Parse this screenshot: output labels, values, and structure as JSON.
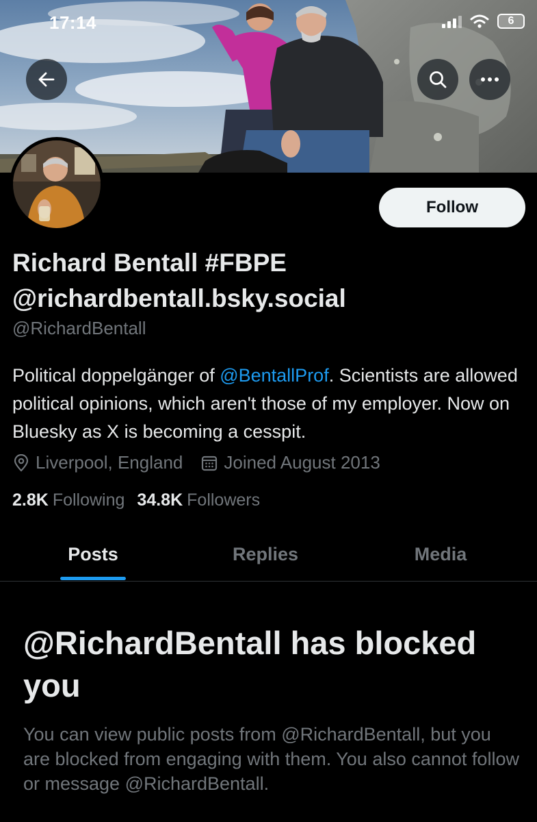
{
  "status_bar": {
    "time": "17:14",
    "battery": "6"
  },
  "header": {
    "back_icon": "arrow-left-icon",
    "search_icon": "search-icon",
    "more_icon": "more-horizontal-icon"
  },
  "profile": {
    "follow_label": "Follow",
    "display_name_line1": "Richard Bentall #FBPE",
    "display_name_line2": "@richardbentall.bsky.social",
    "handle": "@RichardBentall",
    "bio_before": "Political doppelgänger of ",
    "bio_mention": "@BentallProf",
    "bio_after": ". Scientists are allowed political opinions, which aren't those of my employer. Now on Bluesky as X is becoming a cesspit.",
    "location": "Liverpool, England",
    "joined": "Joined August 2013",
    "following_count": "2.8K",
    "following_label": "Following",
    "followers_count": "34.8K",
    "followers_label": "Followers"
  },
  "tabs": [
    {
      "label": "Posts",
      "active": true
    },
    {
      "label": "Replies",
      "active": false
    },
    {
      "label": "Media",
      "active": false
    }
  ],
  "blocked": {
    "title": "@RichardBentall has blocked you",
    "body": "You can view public posts from @RichardBentall, but you are blocked from engaging with them. You also cannot follow or message @RichardBentall."
  },
  "colors": {
    "background": "#000000",
    "text_primary": "#e7e9ea",
    "text_secondary": "#71767b",
    "accent": "#1d9bf0",
    "follow_button_bg": "#eff3f4"
  }
}
